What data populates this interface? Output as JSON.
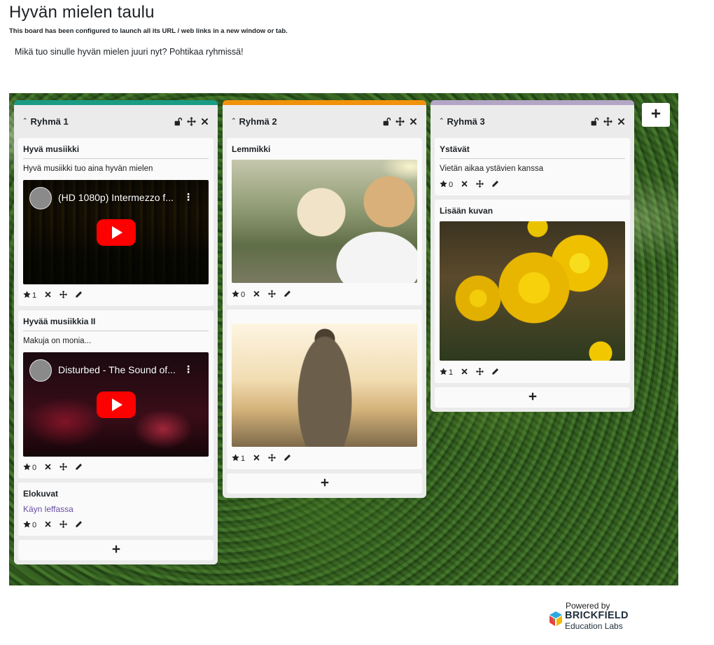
{
  "page": {
    "title": "Hyvän mielen taulu",
    "config_note": "This board has been configured to launch all its URL / web links in a new window or tab.",
    "intro": "Mikä tuo sinulle hyvän mielen juuri nyt? Pohtikaa ryhmissä!"
  },
  "columns": [
    {
      "title": "Ryhmä 1",
      "accent": "#1a9c84",
      "cards": [
        {
          "title": "Hyvä musiikki",
          "text": "Hyvä musiikki tuo aina hyvän mielen",
          "video_title": "(HD 1080p) Intermezzo f...",
          "rating": "1"
        },
        {
          "title": "Hyvää musiikkia II",
          "text": "Makuja on monia...",
          "video_title": "Disturbed - The Sound of...",
          "rating": "0"
        },
        {
          "title": "Elokuvat",
          "link": "Käyn leffassa",
          "rating": "0"
        }
      ]
    },
    {
      "title": "Ryhmä 2",
      "accent": "#f2920b",
      "cards": [
        {
          "title": "Lemmikki",
          "rating": "0"
        },
        {
          "title": "",
          "rating": "1"
        }
      ]
    },
    {
      "title": "Ryhmä 3",
      "accent": "#b3a5c6",
      "cards": [
        {
          "title": "Ystävät",
          "text": "Vietän aikaa ystävien kanssa",
          "rating": "0"
        },
        {
          "title": "Lisään kuvan",
          "rating": "1"
        }
      ]
    }
  ],
  "icons": {
    "lock": "unlock-icon",
    "move": "move-icon",
    "delete": "close-icon",
    "edit": "pencil-icon",
    "star": "star-icon",
    "add": "plus-icon"
  },
  "brand": {
    "powered_by": "Powered by",
    "name": "BRICKFIELD",
    "sub": "Education Labs"
  }
}
